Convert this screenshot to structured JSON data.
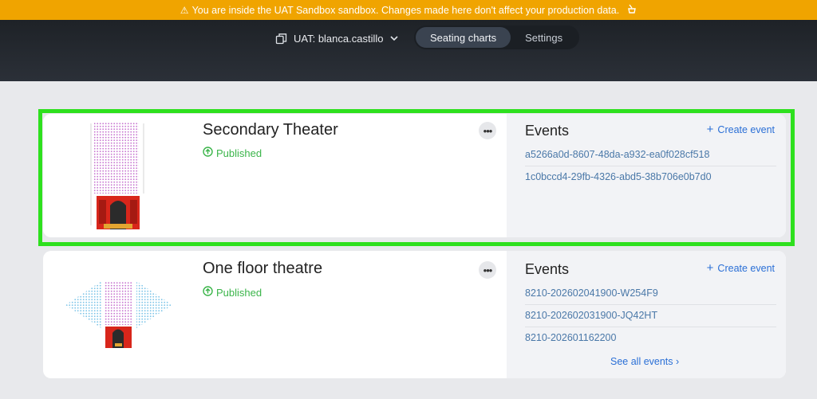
{
  "banner": {
    "text": "You are inside the UAT Sandbox sandbox. Changes made here don't affect your production data.",
    "warn_icon": "warning-icon",
    "close_icon": "sweep-icon"
  },
  "header": {
    "workspace": "UAT: blanca.castillo",
    "tabs": [
      {
        "label": "Seating charts",
        "active": true
      },
      {
        "label": "Settings",
        "active": false
      }
    ]
  },
  "charts": [
    {
      "title": "Secondary Theater",
      "status": "Published",
      "events_title": "Events",
      "create_label": "Create event",
      "events": [
        "a5266a0d-8607-48da-a932-ea0f028cf518",
        "1c0bccd4-29fb-4326-abd5-38b706e0b7d0"
      ]
    },
    {
      "title": "One floor theatre",
      "status": "Published",
      "events_title": "Events",
      "create_label": "Create event",
      "events": [
        "8210-202602041900-W254F9",
        "8210-202602031900-JQ42HT",
        "8210-202601162200"
      ],
      "see_all": "See all events"
    }
  ],
  "colors": {
    "banner": "#f0a400",
    "highlight": "#2ee01e",
    "published": "#3bb54a",
    "link": "#2a6fd6"
  }
}
